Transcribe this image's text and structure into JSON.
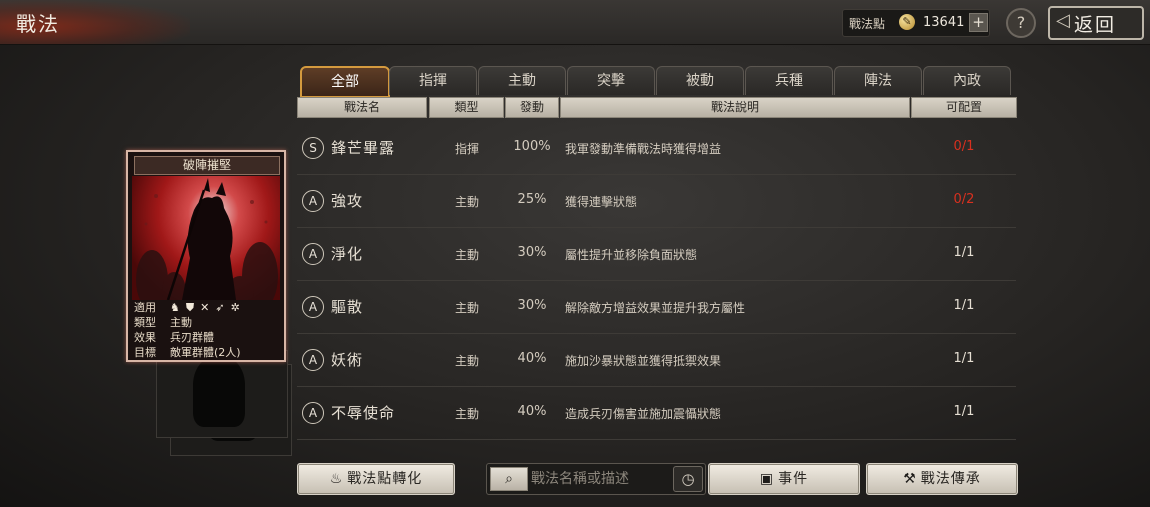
{
  "header": {
    "title": "戰法",
    "points_label": "戰法點",
    "points_value": "13641",
    "plus_label": "+",
    "help_label": "?",
    "back_label": "返回"
  },
  "tabs": [
    {
      "label": "全部",
      "active": true
    },
    {
      "label": "指揮",
      "active": false
    },
    {
      "label": "主動",
      "active": false
    },
    {
      "label": "突擊",
      "active": false
    },
    {
      "label": "被動",
      "active": false
    },
    {
      "label": "兵種",
      "active": false
    },
    {
      "label": "陣法",
      "active": false
    },
    {
      "label": "內政",
      "active": false
    }
  ],
  "columns": {
    "name": "戰法名",
    "type": "類型",
    "rate": "發動",
    "desc": "戰法說明",
    "quota": "可配置"
  },
  "rows": [
    {
      "grade": "S",
      "name": "鋒芒畢露",
      "type": "指揮",
      "rate": "100%",
      "desc": "我軍發動準備戰法時獲得增益",
      "quota": "0/1",
      "quota_color": "#d8301f"
    },
    {
      "grade": "A",
      "name": "強攻",
      "type": "主動",
      "rate": "25%",
      "desc": "獲得連擊狀態",
      "quota": "0/2",
      "quota_color": "#d8301f"
    },
    {
      "grade": "A",
      "name": "淨化",
      "type": "主動",
      "rate": "30%",
      "desc": "屬性提升並移除負面狀態",
      "quota": "1/1",
      "quota_color": "#e6dfd3"
    },
    {
      "grade": "A",
      "name": "驅散",
      "type": "主動",
      "rate": "30%",
      "desc": "解除敵方增益效果並提升我方屬性",
      "quota": "1/1",
      "quota_color": "#e6dfd3"
    },
    {
      "grade": "A",
      "name": "妖術",
      "type": "主動",
      "rate": "40%",
      "desc": "施加沙暴狀態並獲得抵禦效果",
      "quota": "1/1",
      "quota_color": "#e6dfd3"
    },
    {
      "grade": "A",
      "name": "不辱使命",
      "type": "主動",
      "rate": "40%",
      "desc": "造成兵刃傷害並施加震懾狀態",
      "quota": "1/1",
      "quota_color": "#e6dfd3"
    }
  ],
  "card": {
    "title": "破陣摧堅",
    "apply_key": "適用",
    "type_key": "類型",
    "type_val": "主動",
    "effect_key": "效果",
    "effect_val": "兵刃群體",
    "target_key": "目標",
    "target_val": "敵軍群體(2人)",
    "suit_icons": [
      "cavalry-icon",
      "shield-icon",
      "bow-icon",
      "spear-icon",
      "wheel-icon"
    ]
  },
  "buttons": {
    "convert_label": "戰法點轉化",
    "event_label": "事件",
    "inherit_label": "戰法傳承"
  },
  "search": {
    "placeholder": "戰法名稱或描述"
  }
}
